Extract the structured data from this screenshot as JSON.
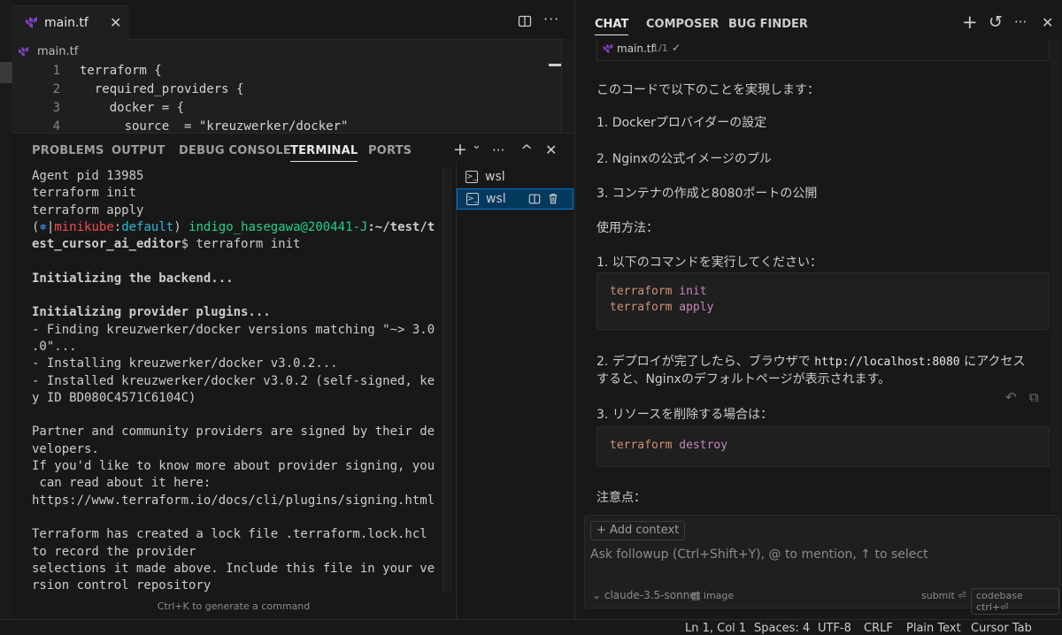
{
  "editor": {
    "tab_label": "main.tf",
    "tab_close": "✕",
    "more": "···",
    "breadcrumb": "main.tf",
    "lines": [
      {
        "num": "1",
        "text": "terraform {"
      },
      {
        "num": "2",
        "text": "  required_providers {"
      },
      {
        "num": "3",
        "text": "    docker = {"
      },
      {
        "num": "4",
        "text": "      source  = \"kreuzwerker/docker\""
      }
    ]
  },
  "panel": {
    "tabs": [
      "PROBLEMS",
      "OUTPUT",
      "DEBUG CONSOLE",
      "TERMINAL",
      "PORTS"
    ],
    "active_tab": "TERMINAL",
    "icons": {
      "add": "+",
      "chevron": "⌄",
      "more": "···",
      "maximize": "^",
      "close": "✕"
    },
    "terminal_list": [
      {
        "label": "wsl",
        "active": false
      },
      {
        "label": "wsl",
        "active": true
      }
    ],
    "hint": "Ctrl+K to generate a command",
    "terminal": {
      "line1": "Agent pid 13985",
      "line2": "terraform init",
      "line3": "terraform apply",
      "prompt_open": "(",
      "prompt_k8s_icon": "⎈",
      "prompt_sep": "|",
      "prompt_ctx": "minikube",
      "prompt_colon": ":",
      "prompt_ns": "default",
      "prompt_close": ") ",
      "prompt_user": "indigo_hasegawa@200441-J",
      "prompt_path": ":~/test/t",
      "prompt_path2": "est_cursor_ai_editor",
      "prompt_cmd": "$ terraform init",
      "backend": "Initializing the backend...",
      "plugins": "Initializing provider plugins...",
      "find1": "- Finding kreuzwerker/docker versions matching \"~> 3.0",
      "find2": ".0\"...",
      "install1": "- Installing kreuzwerker/docker v3.0.2...",
      "installed1": "- Installed kreuzwerker/docker v3.0.2 (self-signed, ke",
      "installed2": "y ID BD080C4571C6104C)",
      "partner1": "Partner and community providers are signed by their de",
      "partner2": "velopers.",
      "know1": "If you'd like to know more about provider signing, you",
      "know2": " can read about it here:",
      "url": "https://www.terraform.io/docs/cli/plugins/signing.html",
      "lock1": "Terraform has created a lock file .terraform.lock.hcl",
      "lock2": "to record the provider",
      "lock3": "selections it made above. Include this file in your ve",
      "lock4": "rsion control repository"
    }
  },
  "chat": {
    "tabs": [
      "CHAT",
      "COMPOSER",
      "BUG FINDER"
    ],
    "active_tab": "CHAT",
    "icons": {
      "new": "+",
      "history": "↺",
      "more": "···",
      "close": "✕"
    },
    "file_chip": {
      "name": "main.tf",
      "count": "1/1",
      "check": "✓"
    },
    "p_intro": "このコードで以下のことを実現します：",
    "p_item1": "1. Dockerプロバイダーの設定",
    "p_item2": "2. Nginxの公式イメージのプル",
    "p_item3": "3. コンテナの作成と8080ポートの公開",
    "p_usage": "使用方法：",
    "p_step1": "1. 以下のコマンドを実行してください：",
    "code1": [
      {
        "cmd": "terraform",
        "arg": "init"
      },
      {
        "cmd": "terraform",
        "arg": "apply"
      }
    ],
    "p_step2_a": "2. デプロイが完了したら、ブラウザで ",
    "p_step2_code": "http://localhost:8080",
    "p_step2_b": " にアクセス",
    "p_step2_c": "すると、Nginxのデフォルトページが表示されます。",
    "p_step3": "3. リソースを削除する場合は：",
    "code2": {
      "cmd": "terraform",
      "arg": "destroy"
    },
    "p_notes": "注意点：",
    "input": {
      "add_context": "+ Add context",
      "placeholder": "Ask followup (Ctrl+Shift+Y), @ to mention, ↑ to select",
      "model": "⌄ claude-3.5-sonnet",
      "image": "image",
      "submit": "submit ⏎",
      "codebase": "codebase ctrl+⏎"
    }
  },
  "statusbar": {
    "position": "Ln 1, Col 1",
    "spaces": "Spaces: 4",
    "encoding": "UTF-8",
    "eol": "CRLF",
    "language": "Plain Text",
    "cursor_tab": "Cursor Tab"
  },
  "colors": {
    "accent": "#0078d4",
    "terraform": "#7b42bc"
  }
}
